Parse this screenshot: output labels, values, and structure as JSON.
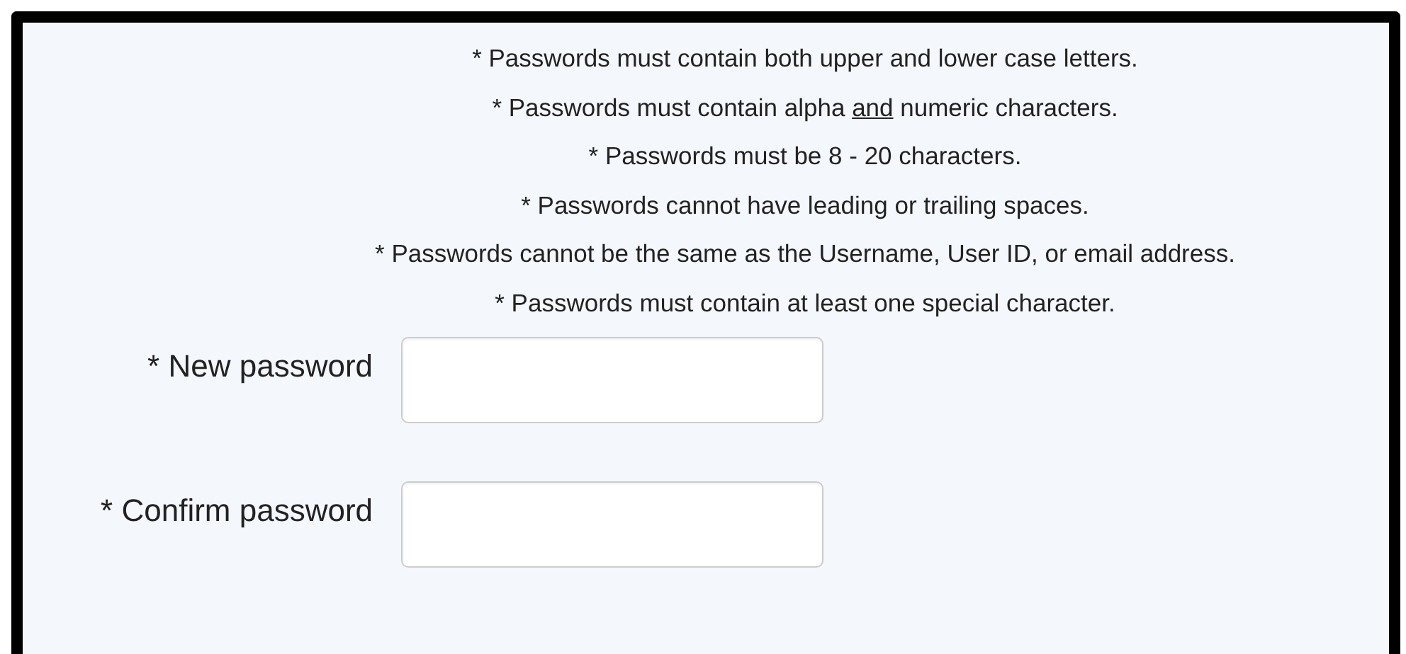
{
  "rules": [
    {
      "before": "* Passwords must contain both upper and lower case letters."
    },
    {
      "before": "* Passwords must contain alpha ",
      "underlined": "and",
      "after": " numeric characters."
    },
    {
      "before": "* Passwords must be 8 - 20 characters."
    },
    {
      "before": "* Passwords cannot have leading or trailing spaces."
    },
    {
      "before": "* Passwords cannot be the same as the Username, User ID, or email address."
    },
    {
      "before": "* Passwords must contain at least one special character."
    }
  ],
  "fields": [
    {
      "label": "* New password"
    },
    {
      "label": "* Confirm password"
    }
  ]
}
